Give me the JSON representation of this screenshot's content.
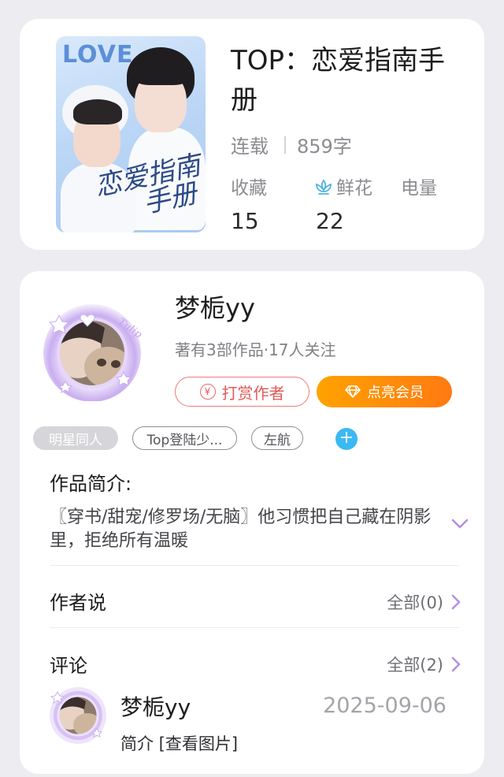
{
  "book": {
    "cover_text": "LOVE",
    "cover_title_line1": "恋爱指南",
    "cover_title_line2": "手册",
    "title": "TOP：恋爱指南手册",
    "status": "连载",
    "word_count": "859字",
    "stats": {
      "favorites_label": "收藏",
      "favorites_value": "15",
      "flowers_label": "鲜花",
      "flowers_value": "22",
      "power_label": "电量"
    }
  },
  "author": {
    "name": "梦栀yy",
    "subtitle": "著有3部作品·17人关注",
    "reward_button": "打赏作者",
    "reward_icon_glyph": "¥",
    "vip_button": "点亮会员"
  },
  "tags": [
    "明星同人",
    "Top登陆少...",
    "左航"
  ],
  "intro": {
    "title": "作品简介:",
    "text": "〖穿书/甜宠/修罗场/无脑〗他习惯把自己藏在阴影里，拒绝所有温暖"
  },
  "author_says": {
    "title": "作者说",
    "all_label": "全部(0)"
  },
  "comments": {
    "title": "评论",
    "all_label": "全部(2)",
    "items": [
      {
        "name": "梦栀yy",
        "date": "2025-09-06",
        "text": "简介 [查看图片]"
      }
    ]
  },
  "colors": {
    "accent_purple": "#b58ee6",
    "vip_orange": "#ff8c0a",
    "reward_red": "#e05a5a",
    "tag_add_blue": "#3ab9f2",
    "flower_blue": "#4fb3e0"
  },
  "icons": {
    "flower": "lotus-flower-icon",
    "vip": "diamond-icon",
    "reward": "yen-coin-icon",
    "add_tag": "plus-icon",
    "expand": "chevron-down-icon",
    "more": "chevron-right-icon"
  }
}
